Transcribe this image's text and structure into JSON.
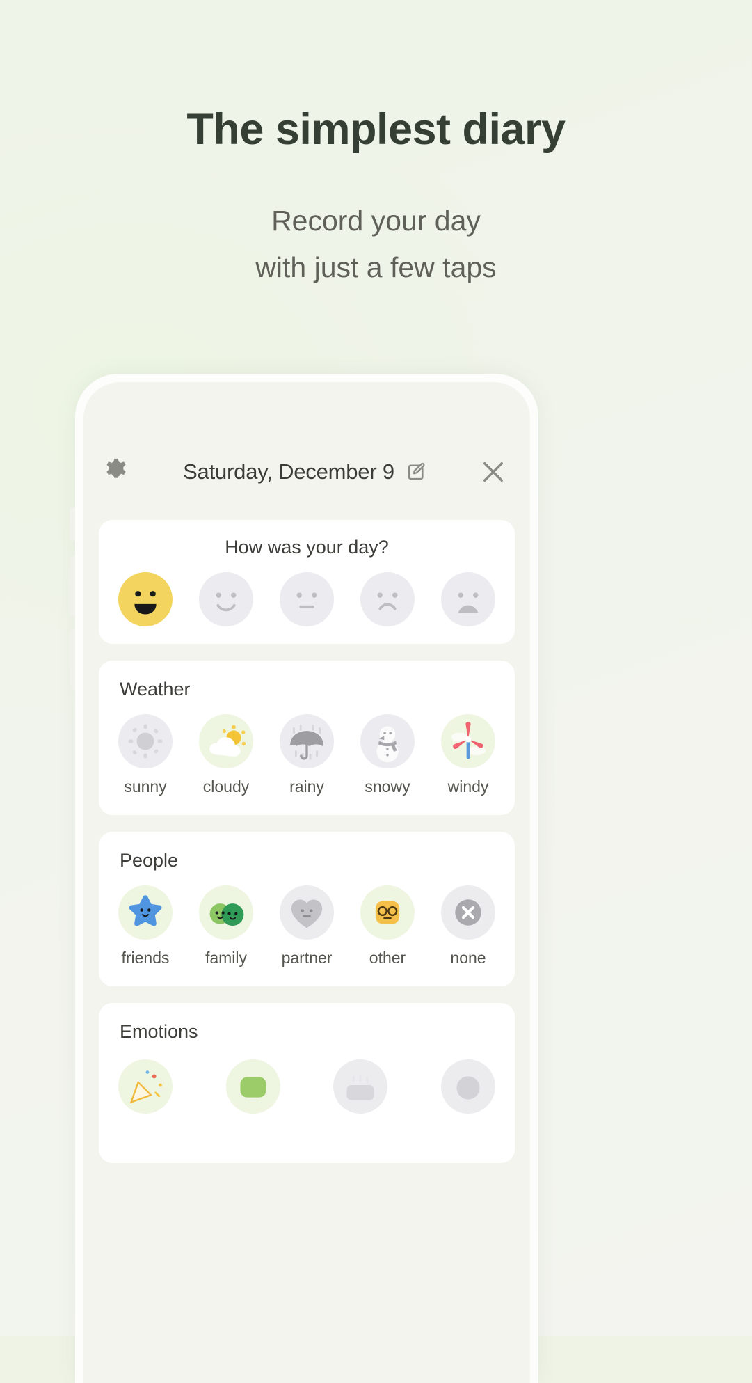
{
  "hero": {
    "title": "The simplest diary",
    "subtitle_line1": "Record your day",
    "subtitle_line2": "with just a few taps"
  },
  "colors": {
    "page_bg": "#eef4e7",
    "title": "#363f33",
    "subtitle": "#5f6159",
    "card_bg": "#ffffff",
    "screen_bg": "#f4f4ef",
    "selected_yellow": "#f2d45f",
    "selected_green": "#eef5e1",
    "inactive_grey": "#ececf0",
    "icon_grey": "#8b8b86"
  },
  "app": {
    "header": {
      "settings_icon": "gear-icon",
      "date_label": "Saturday, December 9",
      "edit_icon": "edit-pencil-icon",
      "close_icon": "close-x-icon"
    },
    "mood_card": {
      "title": "How was your day?",
      "options": [
        {
          "id": "great",
          "icon": "face-grinning-icon",
          "selected": true
        },
        {
          "id": "good",
          "icon": "face-smile-icon",
          "selected": false
        },
        {
          "id": "neutral",
          "icon": "face-neutral-icon",
          "selected": false
        },
        {
          "id": "bad",
          "icon": "face-frown-icon",
          "selected": false
        },
        {
          "id": "awful",
          "icon": "face-sad-icon",
          "selected": false
        }
      ]
    },
    "weather_card": {
      "title": "Weather",
      "options": [
        {
          "label": "sunny",
          "icon": "sun-icon",
          "selected": false
        },
        {
          "label": "cloudy",
          "icon": "sun-cloud-icon",
          "selected": true
        },
        {
          "label": "rainy",
          "icon": "umbrella-rain-icon",
          "selected": false
        },
        {
          "label": "snowy",
          "icon": "snowman-icon",
          "selected": false
        },
        {
          "label": "windy",
          "icon": "windmill-icon",
          "selected": true
        }
      ]
    },
    "people_card": {
      "title": "People",
      "options": [
        {
          "label": "friends",
          "icon": "star-face-icon",
          "selected": true
        },
        {
          "label": "family",
          "icon": "two-faces-icon",
          "selected": true
        },
        {
          "label": "partner",
          "icon": "heart-face-icon",
          "selected": false
        },
        {
          "label": "other",
          "icon": "glasses-face-icon",
          "selected": true
        },
        {
          "label": "none",
          "icon": "circle-x-icon",
          "selected": false
        }
      ]
    },
    "emotions_card": {
      "title": "Emotions",
      "options": [
        {
          "id": "excited",
          "icon": "party-icon",
          "selected": true
        },
        {
          "id": "calm",
          "icon": "leaf-icon",
          "selected": true
        },
        {
          "id": "tired",
          "icon": "sleepy-icon",
          "selected": false
        },
        {
          "id": "bored",
          "icon": "cloud-icon",
          "selected": false
        }
      ]
    }
  }
}
